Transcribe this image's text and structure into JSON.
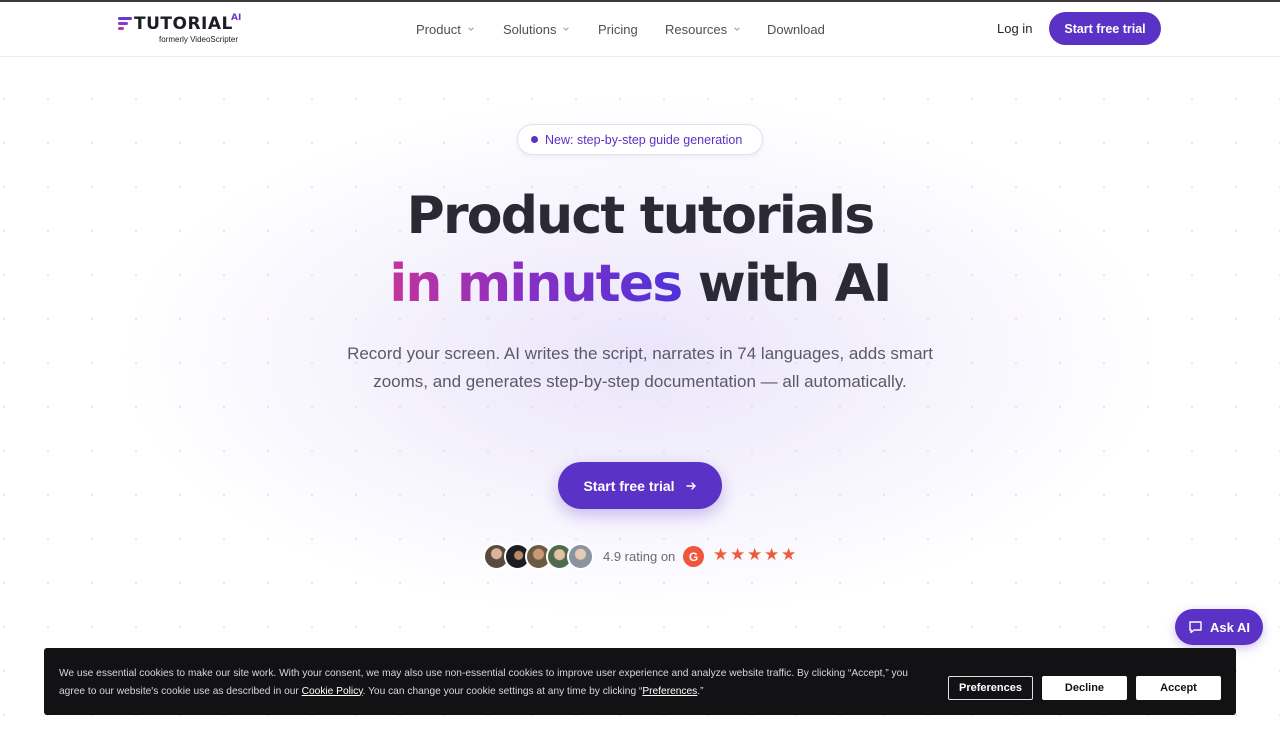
{
  "header": {
    "logo_word": "TUTORIAL",
    "logo_ai": "AI",
    "logo_formerly": "formerly VideoScripter",
    "nav": [
      {
        "label": "Product",
        "has_dropdown": true
      },
      {
        "label": "Solutions",
        "has_dropdown": true
      },
      {
        "label": "Pricing",
        "has_dropdown": false
      },
      {
        "label": "Resources",
        "has_dropdown": true
      },
      {
        "label": "Download",
        "has_dropdown": false
      }
    ],
    "login_label": "Log in",
    "trial_label": "Start free trial"
  },
  "hero": {
    "badge": "New: step-by-step guide generation",
    "title_line1": "Product tutorials",
    "title_highlight": "in minutes",
    "title_rest": " with AI",
    "subtitle": "Record your screen. AI writes the script, narrates in 74 languages, adds smart zooms, and generates step-by-step documentation — all automatically.",
    "cta_label": "Start free trial",
    "cta_icon": "arrow-right-icon",
    "rating_text": "4.9 rating on",
    "rating_source_icon": "g2-logo-icon",
    "stars": 5
  },
  "ask_ai": {
    "label": "Ask AI",
    "icon": "chat-bubble-icon"
  },
  "cookie": {
    "text_before": "We use essential cookies to make our site work. With your consent, we may also use non-essential cookies to improve user experience and analyze website traffic. By clicking “Accept,” you agree to our website's cookie use as described in our ",
    "policy_link": "Cookie Policy",
    "text_middle": ". You can change your cookie settings at any time by clicking “",
    "preferences_link": "Preferences",
    "text_after": ".”",
    "preferences_button": "Preferences",
    "decline_button": "Decline",
    "accept_button": "Accept"
  },
  "colors": {
    "brand": "#5b32c6",
    "heading": "#2a2a34",
    "gradient_start": "#c4349a",
    "gradient_end": "#4f33d8",
    "star": "#ee5a3c",
    "cookie_bg": "#121214"
  }
}
